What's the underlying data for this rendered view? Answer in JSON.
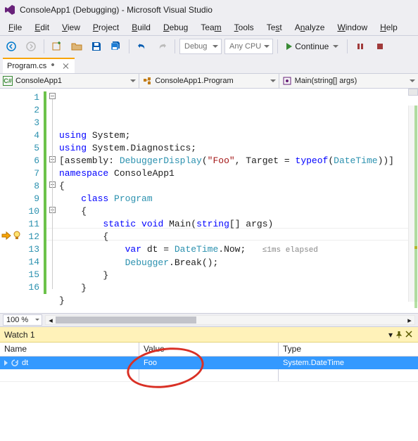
{
  "titlebar": {
    "title": "ConsoleApp1 (Debugging) - Microsoft Visual Studio"
  },
  "menu": {
    "file": "File",
    "edit": "Edit",
    "view": "View",
    "project": "Project",
    "build": "Build",
    "debug": "Debug",
    "team": "Team",
    "tools": "Tools",
    "test": "Test",
    "analyze": "Analyze",
    "window": "Window",
    "help": "Help"
  },
  "toolbar": {
    "config": "Debug",
    "platform": "Any CPU",
    "continue_label": "Continue"
  },
  "tabs": {
    "active": "Program.cs"
  },
  "navbar": {
    "project": "ConsoleApp1",
    "class": "ConsoleApp1.Program",
    "method": "Main(string[] args)"
  },
  "editor": {
    "zoom": "100 %",
    "current_line": 12,
    "elapsed": "≤1ms elapsed",
    "lines": [
      {
        "n": 1,
        "indent": 0,
        "tokens": [
          [
            "kw",
            "using"
          ],
          [
            "",
            " System;"
          ]
        ]
      },
      {
        "n": 2,
        "indent": 0,
        "tokens": [
          [
            "kw",
            "using"
          ],
          [
            "",
            " System.Diagnostics;"
          ]
        ]
      },
      {
        "n": 3,
        "indent": 0,
        "tokens": []
      },
      {
        "n": 4,
        "indent": 0,
        "tokens": [
          [
            "",
            "[assembly: "
          ],
          [
            "type",
            "DebuggerDisplay"
          ],
          [
            "",
            "("
          ],
          [
            "str",
            "\"Foo\""
          ],
          [
            "",
            ", Target = "
          ],
          [
            "kw",
            "typeof"
          ],
          [
            "",
            "("
          ],
          [
            "type",
            "DateTime"
          ],
          [
            "",
            "))]"
          ]
        ]
      },
      {
        "n": 5,
        "indent": 0,
        "tokens": []
      },
      {
        "n": 6,
        "indent": 0,
        "tokens": [
          [
            "kw",
            "namespace"
          ],
          [
            "",
            " ConsoleApp1"
          ]
        ]
      },
      {
        "n": 7,
        "indent": 0,
        "tokens": [
          [
            "",
            "{"
          ]
        ]
      },
      {
        "n": 8,
        "indent": 1,
        "tokens": [
          [
            "kw",
            "class"
          ],
          [
            "",
            " "
          ],
          [
            "type",
            "Program"
          ]
        ]
      },
      {
        "n": 9,
        "indent": 1,
        "tokens": [
          [
            "",
            "{"
          ]
        ]
      },
      {
        "n": 10,
        "indent": 2,
        "tokens": [
          [
            "kw",
            "static"
          ],
          [
            "",
            " "
          ],
          [
            "kw",
            "void"
          ],
          [
            "",
            " Main("
          ],
          [
            "kw",
            "string"
          ],
          [
            "",
            "[] args)"
          ]
        ]
      },
      {
        "n": 11,
        "indent": 2,
        "tokens": [
          [
            "",
            "{"
          ]
        ]
      },
      {
        "n": 12,
        "indent": 3,
        "tokens": [
          [
            "kw",
            "var"
          ],
          [
            "",
            " dt = "
          ],
          [
            "type",
            "DateTime"
          ],
          [
            "",
            ".Now;"
          ]
        ]
      },
      {
        "n": 13,
        "indent": 3,
        "tokens": [
          [
            "type",
            "Debugger"
          ],
          [
            "",
            ".Break();"
          ]
        ]
      },
      {
        "n": 14,
        "indent": 2,
        "tokens": [
          [
            "",
            "}"
          ]
        ]
      },
      {
        "n": 15,
        "indent": 1,
        "tokens": [
          [
            "",
            "}"
          ]
        ]
      },
      {
        "n": 16,
        "indent": 0,
        "tokens": [
          [
            "",
            "}"
          ]
        ]
      }
    ]
  },
  "watch": {
    "title": "Watch 1",
    "columns": {
      "name": "Name",
      "value": "Value",
      "type": "Type"
    },
    "rows": [
      {
        "name": "dt",
        "value": "Foo",
        "type": "System.DateTime"
      }
    ]
  }
}
